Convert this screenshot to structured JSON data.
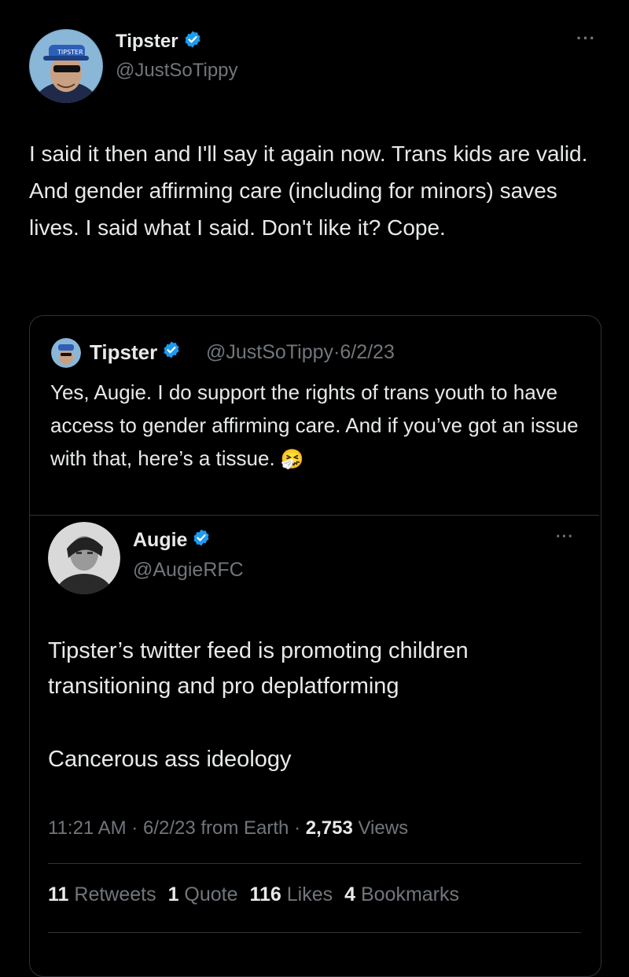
{
  "main_tweet": {
    "author_name": "Tipster",
    "author_handle": "@JustSoTippy",
    "more_label": "···",
    "text": "I said it then and I'll say it again now. Trans kids are valid. And gender affirming care (including for minors) saves lives. I said what I said. Don't like it? Cope."
  },
  "quoted_tweet": {
    "author_name": "Tipster",
    "author_handle": "@JustSoTippy",
    "separator": "·",
    "date": "6/2/23",
    "text": "Yes, Augie. I do support the rights of trans youth to have access to gender affirming care. And if you’ve got an issue with that, here’s a tissue.",
    "emoji": "🤧"
  },
  "nested_tweet": {
    "author_name": "Augie",
    "author_handle": "@AugieRFC",
    "more_label": "···",
    "text_1": "Tipster’s twitter feed is promoting children transitioning and pro deplatforming",
    "text_2": "Cancerous ass ideology",
    "meta": {
      "time": "11:21 AM",
      "sep1": "·",
      "date": "6/2/23",
      "source": "from Earth",
      "sep2": "·",
      "views_count": "2,753",
      "views_label": "Views"
    },
    "stats": {
      "retweets_count": "11",
      "retweets_label": "Retweets",
      "quote_count": "1",
      "quote_label": "Quote",
      "likes_count": "116",
      "likes_label": "Likes",
      "bookmarks_count": "4",
      "bookmarks_label": "Bookmarks"
    }
  },
  "colors": {
    "background": "#000000",
    "text": "#e7e9ea",
    "muted": "#71767b",
    "verified": "#1d9bf0",
    "border": "#2f3336"
  },
  "icons": [
    "avatar-tipster",
    "verified-badge-icon",
    "more-icon",
    "sneezing-face-emoji",
    "avatar-augie"
  ]
}
